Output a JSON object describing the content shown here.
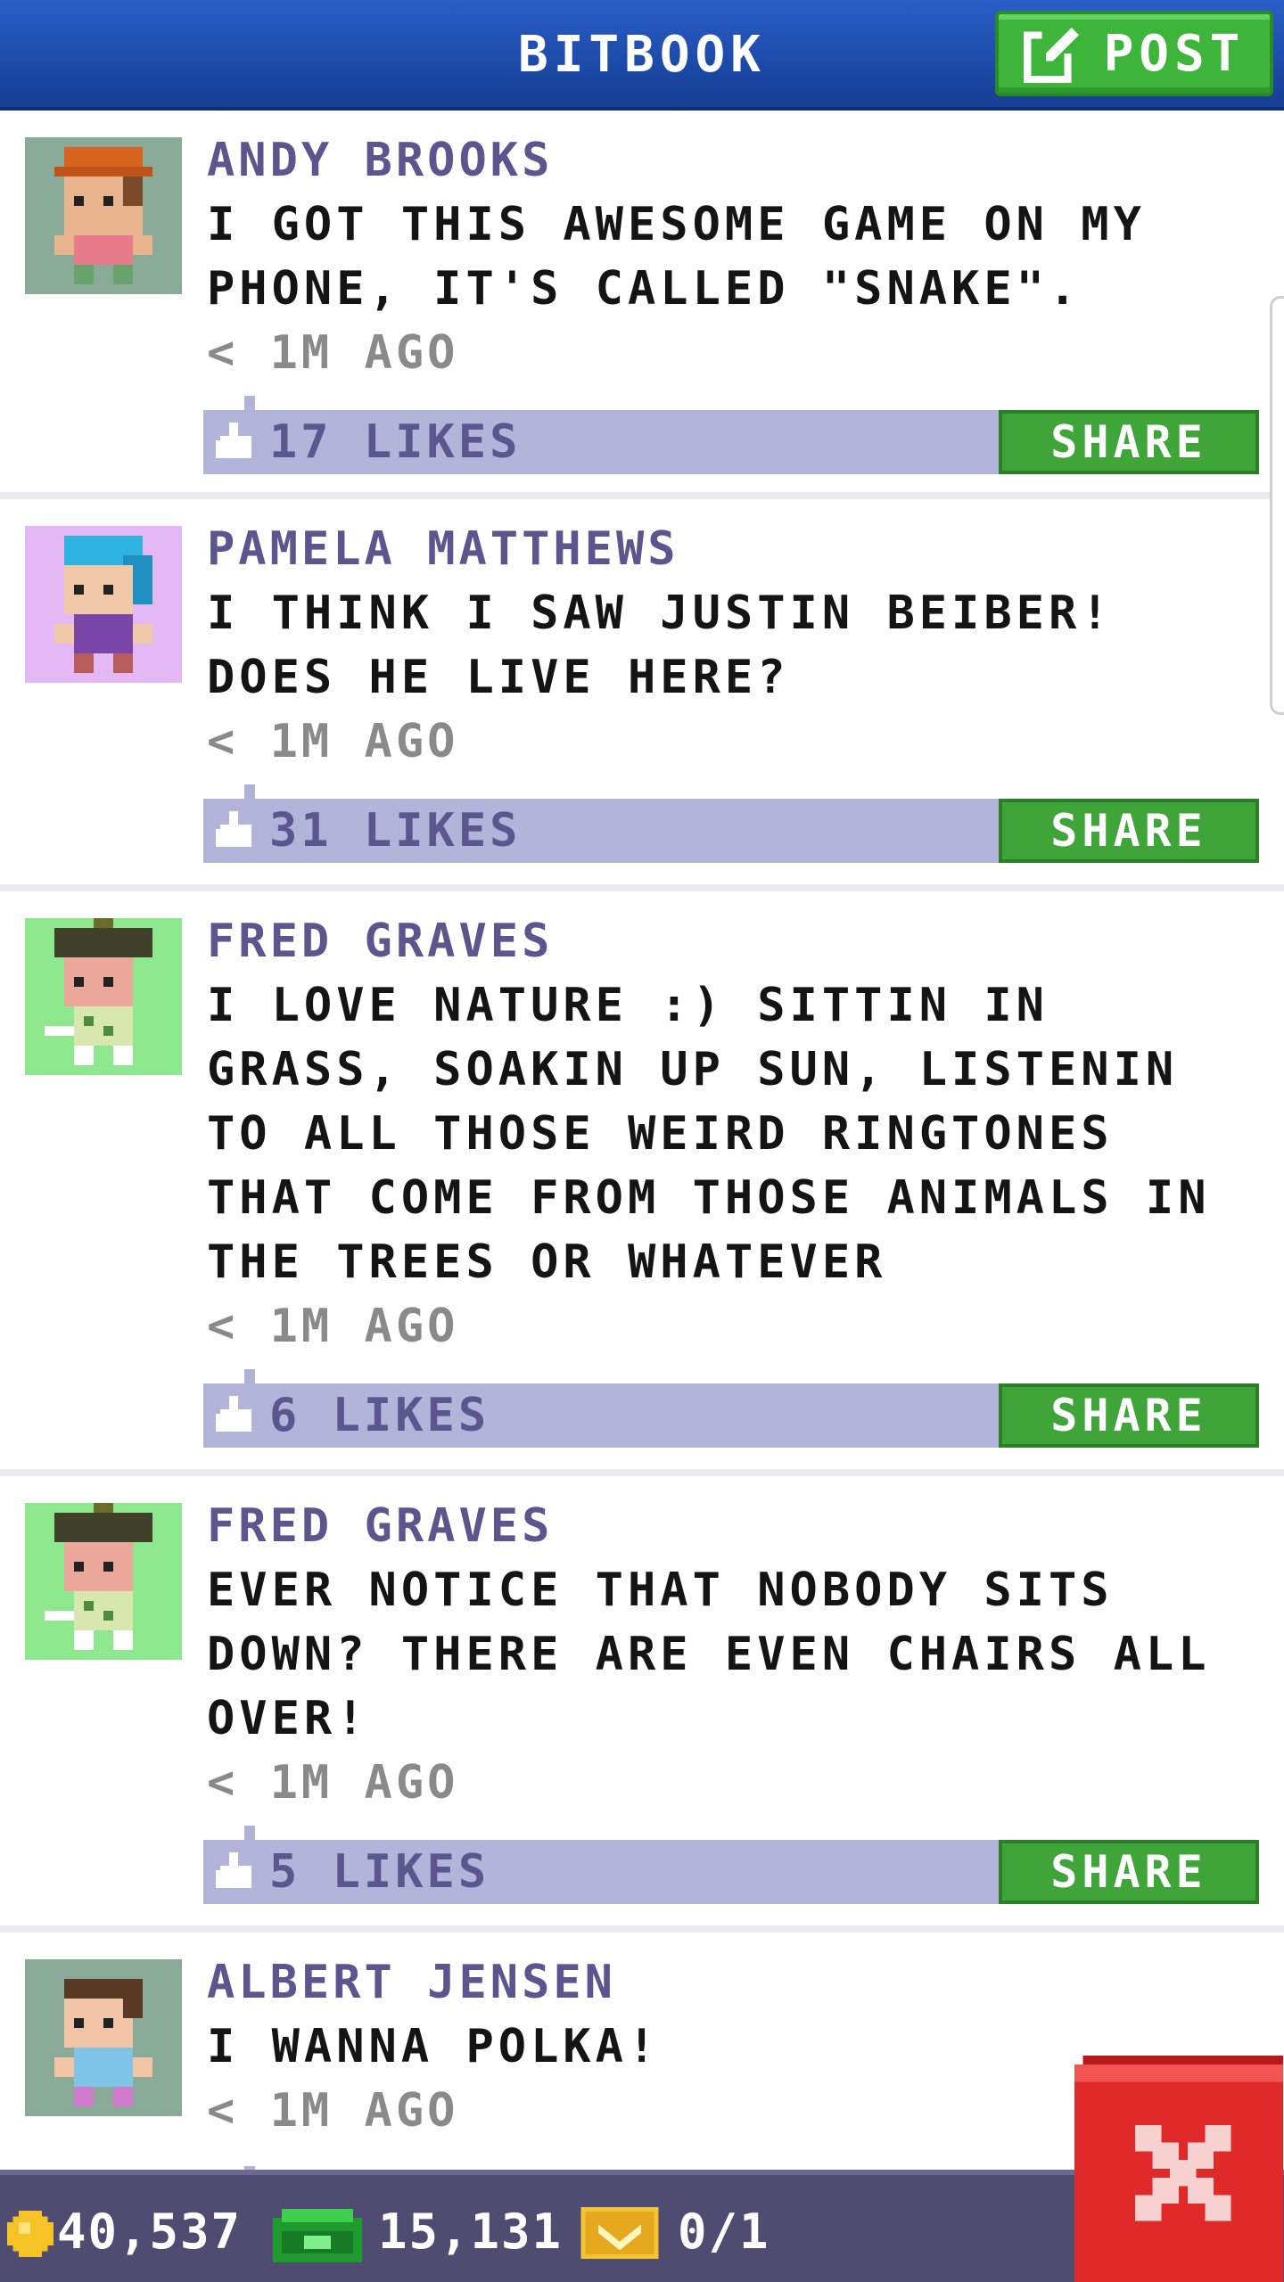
{
  "header": {
    "title": "BITBOOK",
    "post_label": "POST"
  },
  "posts": [
    {
      "author": "ANDY BROOKS",
      "message": "I GOT THIS AWESOME GAME ON MY PHONE, IT'S CALLED \"SNAKE\".",
      "time": "< 1M AGO",
      "likes": "17 LIKES",
      "share": "SHARE"
    },
    {
      "author": "PAMELA MATTHEWS",
      "message": "I THINK I SAW JUSTIN BEIBER! DOES HE LIVE HERE?",
      "time": "< 1M AGO",
      "likes": "31 LIKES",
      "share": "SHARE"
    },
    {
      "author": "FRED GRAVES",
      "message": "I LOVE NATURE :) SITTIN IN GRASS, SOAKIN UP SUN, LISTENIN TO ALL THOSE WEIRD RINGTONES THAT COME FROM THOSE ANIMALS IN THE TREES OR WHATEVER",
      "time": "< 1M AGO",
      "likes": "6 LIKES",
      "share": "SHARE"
    },
    {
      "author": "FRED GRAVES",
      "message": "EVER NOTICE THAT NOBODY SITS DOWN? THERE ARE EVEN CHAIRS ALL OVER!",
      "time": "< 1M AGO",
      "likes": "5 LIKES",
      "share": "SHARE"
    },
    {
      "author": "ALBERT JENSEN",
      "message": "I WANNA POLKA!",
      "time": "< 1M AGO"
    }
  ],
  "bottom_bar": {
    "coins": "40,537",
    "bux": "15,131",
    "vip": "0/1"
  },
  "icons": {
    "post": "edit-icon",
    "like": "thumbs-up-icon",
    "coin": "coin-icon",
    "bux": "bux-icon",
    "vip": "vip-ticket-icon",
    "close": "close-icon"
  },
  "colors": {
    "header": "#1c4aa8",
    "post_button": "#3cb53a",
    "author": "#5c568e",
    "like_bar": "#b3b4d9",
    "share_button": "#3fa538",
    "bottom_bar": "#4e4c71",
    "close_button": "#e02a2a"
  }
}
